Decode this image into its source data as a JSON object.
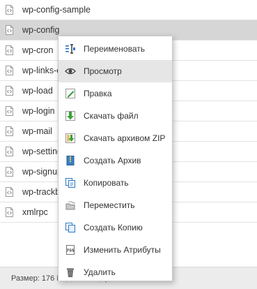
{
  "files": [
    {
      "name": "wp-config-sample"
    },
    {
      "name": "wp-config",
      "selected": true
    },
    {
      "name": "wp-cron"
    },
    {
      "name": "wp-links-opml"
    },
    {
      "name": "wp-load"
    },
    {
      "name": "wp-login"
    },
    {
      "name": "wp-mail"
    },
    {
      "name": "wp-settings"
    },
    {
      "name": "wp-signup"
    },
    {
      "name": "wp-trackback"
    },
    {
      "name": "xmlrpc"
    }
  ],
  "status": {
    "text": "Размер: 176 Кб, папок: 0, файлов: 16"
  },
  "context_menu": {
    "items": [
      {
        "label": "Переименовать",
        "icon": "rename-icon"
      },
      {
        "label": "Просмотр",
        "icon": "eye-icon",
        "hover": true
      },
      {
        "label": "Правка",
        "icon": "edit-icon"
      },
      {
        "label": "Скачать файл",
        "icon": "download-icon"
      },
      {
        "label": "Скачать архивом ZIP",
        "icon": "zip-download-icon"
      },
      {
        "label": "Создать Архив",
        "icon": "archive-icon"
      },
      {
        "label": "Копировать",
        "icon": "copy-icon"
      },
      {
        "label": "Переместить",
        "icon": "move-icon"
      },
      {
        "label": "Создать Копию",
        "icon": "duplicate-icon"
      },
      {
        "label": "Изменить Атрибуты",
        "icon": "attributes-icon"
      },
      {
        "label": "Удалить",
        "icon": "trash-icon"
      }
    ]
  },
  "colors": {
    "selected_row": "#d6d6d6",
    "menu_hover": "#e6e6e6",
    "status_bar": "#ececec"
  }
}
